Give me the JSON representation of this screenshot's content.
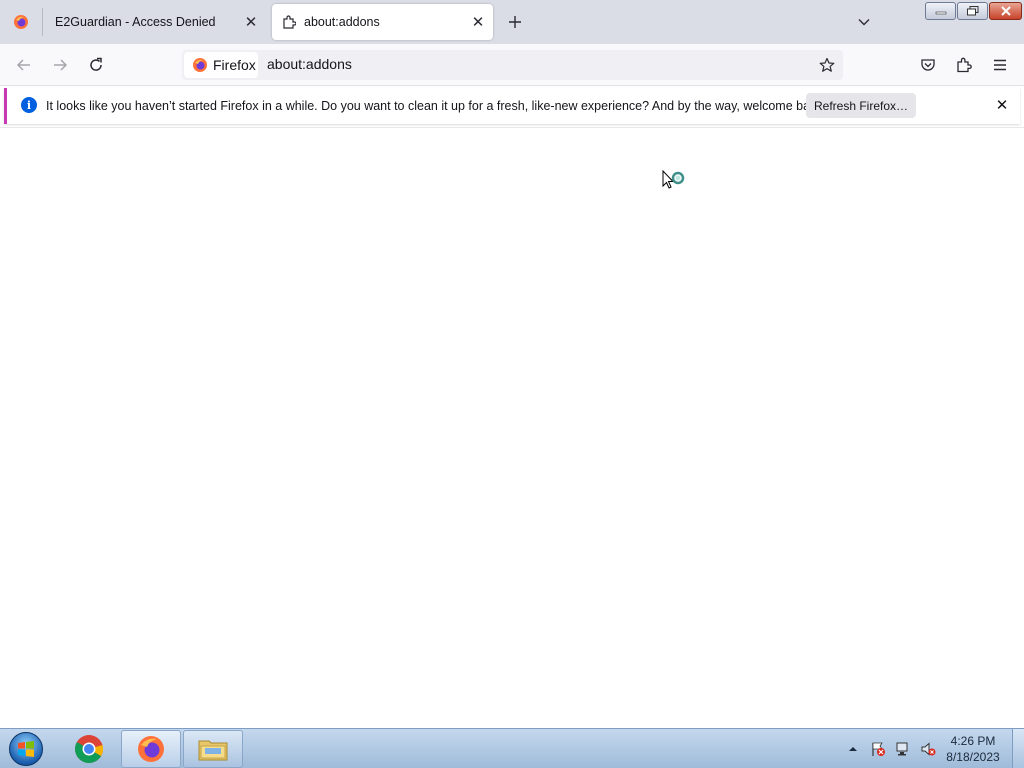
{
  "tabs": [
    {
      "title": "E2Guardian - Access Denied",
      "active": false
    },
    {
      "title": "about:addons",
      "active": true
    }
  ],
  "navbar": {
    "identity_label": "Firefox",
    "url": "about:addons"
  },
  "notification": {
    "message": "It looks like you haven’t started Firefox in a while. Do you want to clean it up for a fresh, like-new experience? And by the way, welcome back!",
    "button_label": "Refresh Firefox…"
  },
  "taskbar": {
    "apps": [
      "chrome-icon",
      "firefox-icon",
      "file-explorer-icon"
    ],
    "clock": {
      "time": "4:26 PM",
      "date": "8/18/2023"
    }
  },
  "colors": {
    "tabstrip_bg": "#dadce6",
    "notice_accent": "#c73bb2",
    "info_blue": "#0060df"
  }
}
